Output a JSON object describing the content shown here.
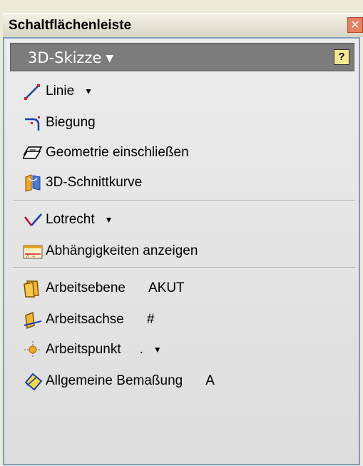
{
  "window": {
    "title": "Schaltflächenleiste",
    "close_label": "✕"
  },
  "header": {
    "label": "3D-Skizze",
    "arrow": "▼",
    "help_label": "?"
  },
  "groups": [
    [
      {
        "label": "Linie",
        "icon": "line-icon",
        "has_dropdown": true,
        "shortcut": ""
      },
      {
        "label": "Biegung",
        "icon": "bend-icon",
        "has_dropdown": false,
        "shortcut": ""
      },
      {
        "label": "Geometrie einschließen",
        "icon": "include-geometry-icon",
        "has_dropdown": false,
        "shortcut": ""
      },
      {
        "label": "3D-Schnittkurve",
        "icon": "intersection-curve-icon",
        "has_dropdown": false,
        "shortcut": ""
      }
    ],
    [
      {
        "label": "Lotrecht",
        "icon": "perpendicular-icon",
        "has_dropdown": true,
        "shortcut": ""
      },
      {
        "label": "Abhängigkeiten anzeigen",
        "icon": "show-constraints-icon",
        "has_dropdown": false,
        "shortcut": ""
      }
    ],
    [
      {
        "label": "Arbeitsebene",
        "icon": "work-plane-icon",
        "has_dropdown": false,
        "shortcut": "AKUT"
      },
      {
        "label": "Arbeitsachse",
        "icon": "work-axis-icon",
        "has_dropdown": false,
        "shortcut": "#"
      },
      {
        "label": "Arbeitspunkt",
        "icon": "work-point-icon",
        "has_dropdown": true,
        "shortcut": "."
      },
      {
        "label": "Allgemeine Bemaßung",
        "icon": "general-dimension-icon",
        "has_dropdown": false,
        "shortcut": "A"
      }
    ]
  ],
  "dropdown_glyph": "▼"
}
